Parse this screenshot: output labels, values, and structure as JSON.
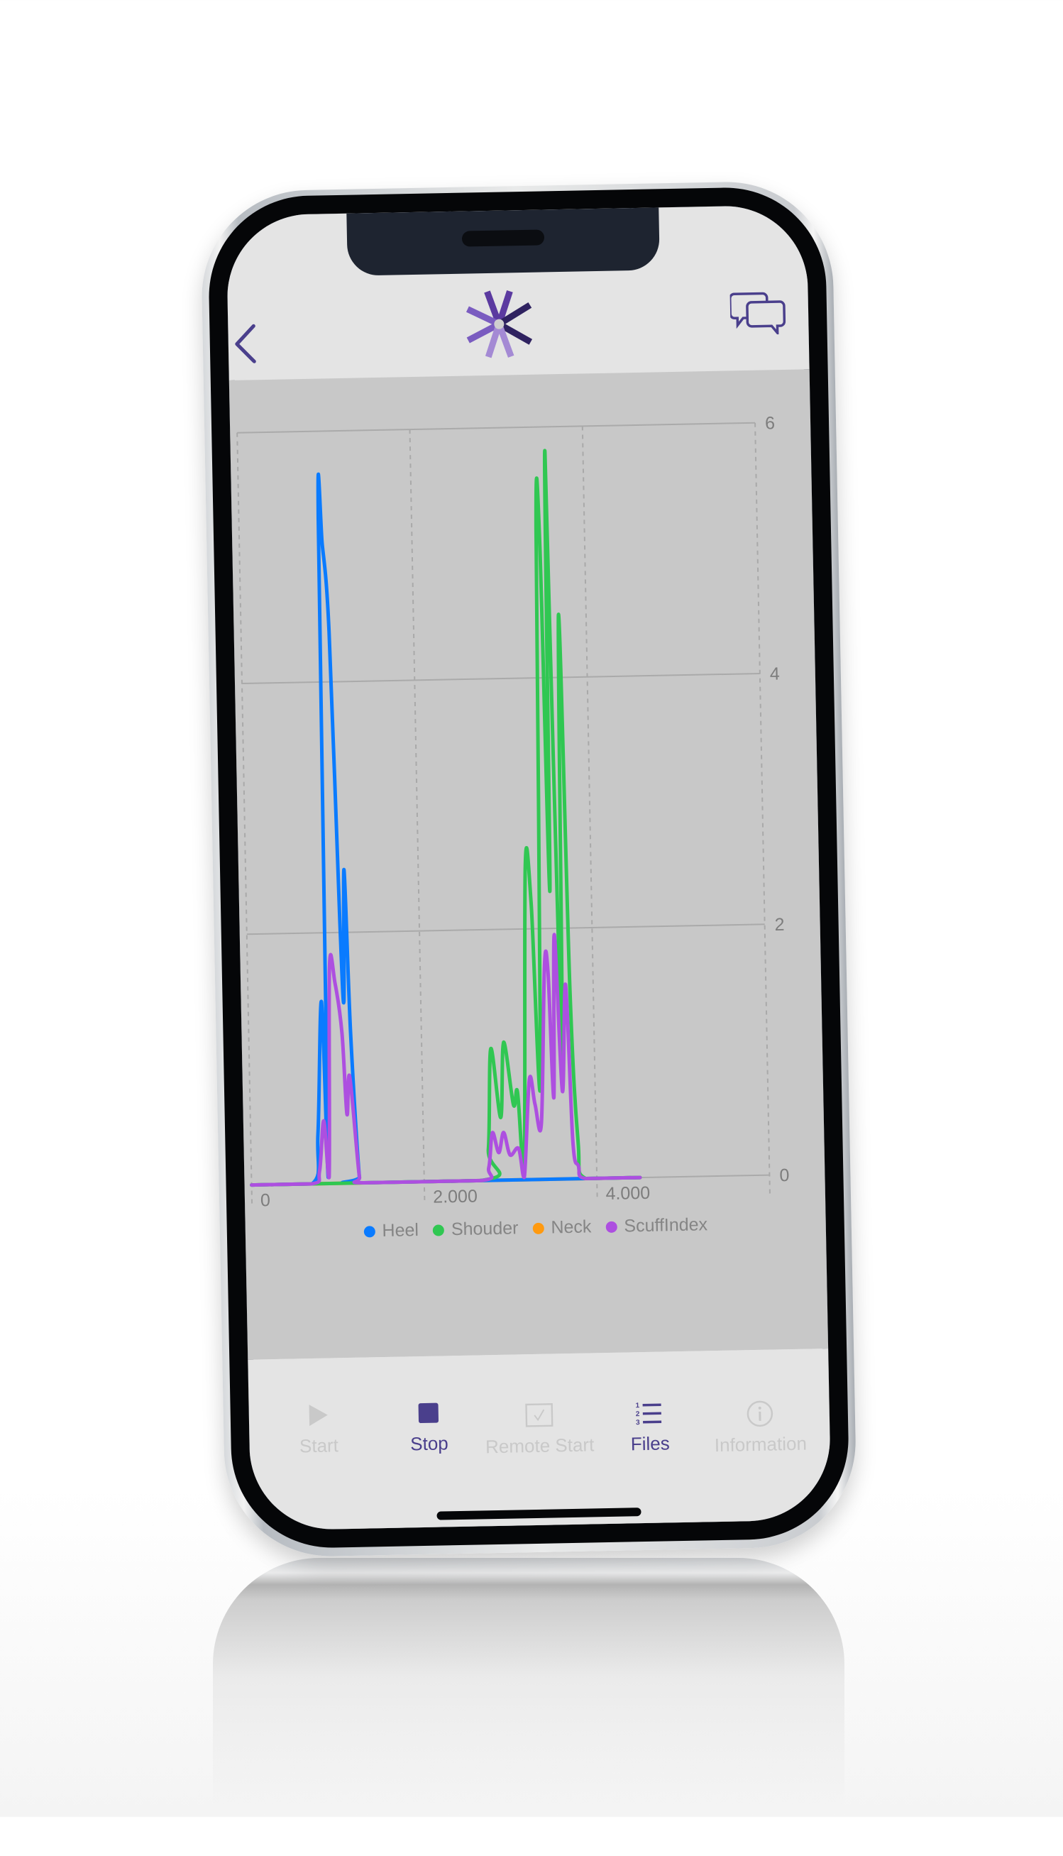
{
  "header": {
    "back_icon": "chevron-left-icon",
    "logo_icon": "asterisk-logo-icon",
    "chat_icon": "chat-bubbles-icon"
  },
  "colors": {
    "accent": "#4a3f8c",
    "header_bg": "#e4e4e4",
    "chart_bg": "#c8c8c8",
    "tab_disabled": "#c9c9c9"
  },
  "chart_data": {
    "type": "line",
    "title": "",
    "xlabel": "",
    "ylabel": "",
    "xlim": [
      0,
      6000
    ],
    "ylim": [
      0,
      6
    ],
    "x_ticks": [
      0,
      2000,
      4000,
      6000
    ],
    "x_tick_labels": [
      "0",
      "2.000",
      "4.000",
      ""
    ],
    "y_ticks": [
      0,
      2,
      4,
      6
    ],
    "y_tick_labels": [
      "0",
      "2",
      "4",
      "6"
    ],
    "y_axis_position": "right",
    "grid": true,
    "legend_position": "bottom",
    "series": [
      {
        "name": "Heel",
        "color": "#0a7bff",
        "x": [
          0,
          700,
          780,
          850,
          890,
          920,
          960,
          1020,
          1080,
          1110,
          1140,
          1180,
          1250,
          1300,
          4500
        ],
        "y": [
          0,
          0,
          0.4,
          1.45,
          0.05,
          5.3,
          5.1,
          4.4,
          2.1,
          1.45,
          2.5,
          1.2,
          0.05,
          0,
          0
        ]
      },
      {
        "name": "Shouder",
        "color": "#30c752",
        "x": [
          0,
          2650,
          2750,
          2800,
          2900,
          2950,
          3050,
          3100,
          3160,
          3240,
          3300,
          3370,
          3440,
          3480,
          3520,
          3560,
          3620,
          3680,
          3730,
          3790,
          3870,
          4500
        ],
        "y": [
          0,
          0,
          0.25,
          1.05,
          0.5,
          1.1,
          0.6,
          0.7,
          0.05,
          2.5,
          2.2,
          0.8,
          5.2,
          5.05,
          2.3,
          5.8,
          0.9,
          4.5,
          1.5,
          0.3,
          0,
          0
        ]
      },
      {
        "name": "Neck",
        "color": "#ff9a10",
        "x": [
          0,
          700,
          1300,
          2650,
          3900,
          4500
        ],
        "y": [
          0,
          0,
          0,
          0,
          0,
          0
        ]
      },
      {
        "name": "ScuffIndex",
        "color": "#ad4fe0",
        "x": [
          0,
          700,
          790,
          850,
          900,
          950,
          1010,
          1080,
          1120,
          1160,
          1250,
          1300,
          2650,
          2750,
          2800,
          2870,
          2930,
          3000,
          3100,
          3160,
          3240,
          3300,
          3370,
          3440,
          3480,
          3520,
          3560,
          3620,
          3680,
          3730,
          3790,
          3870,
          4500
        ],
        "y": [
          0,
          0,
          0.1,
          0.5,
          0.05,
          1.72,
          1.6,
          1.2,
          0.55,
          0.85,
          0.05,
          0,
          0,
          0.1,
          0.38,
          0.22,
          0.38,
          0.2,
          0.25,
          0.02,
          0.8,
          0.6,
          0.45,
          1.7,
          1.65,
          0.65,
          1.95,
          0.7,
          1.55,
          0.3,
          0.1,
          0,
          0
        ]
      }
    ]
  },
  "legend": [
    {
      "label": "Heel",
      "color": "#0a7bff"
    },
    {
      "label": "Shouder",
      "color": "#30c752"
    },
    {
      "label": "Neck",
      "color": "#ff9a10"
    },
    {
      "label": "ScuffIndex",
      "color": "#ad4fe0"
    }
  ],
  "tabbar": {
    "tabs": [
      {
        "label": "Start",
        "icon": "play-icon",
        "state": "disabled"
      },
      {
        "label": "Stop",
        "icon": "stop-icon",
        "state": "active"
      },
      {
        "label": "Remote Start",
        "icon": "checkbox-icon",
        "state": "disabled"
      },
      {
        "label": "Files",
        "icon": "numbered-list-icon",
        "state": "active"
      },
      {
        "label": "Information",
        "icon": "info-icon",
        "state": "disabled"
      }
    ]
  }
}
